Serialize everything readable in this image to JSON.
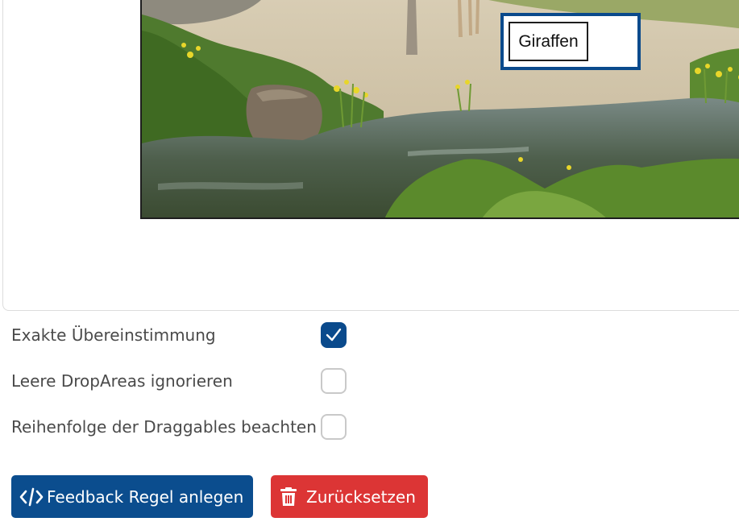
{
  "editor": {
    "draggable_label": "Giraffen"
  },
  "options": [
    {
      "label": "Exakte Übereinstimmung",
      "checked": true
    },
    {
      "label": "Leere DropAreas ignorieren",
      "checked": false
    },
    {
      "label": "Reihenfolge der Draggables beachten",
      "checked": false
    }
  ],
  "actions": {
    "feedback_label": "Feedback Regel anlegen",
    "reset_label": "Zurücksetzen"
  },
  "colors": {
    "primary": "#0b4d8e",
    "danger": "#dc3535",
    "drop_area_border": "#0a4a8c"
  },
  "icons": {
    "feedback": "code-icon",
    "reset": "trash-icon",
    "checked": "check-icon"
  }
}
